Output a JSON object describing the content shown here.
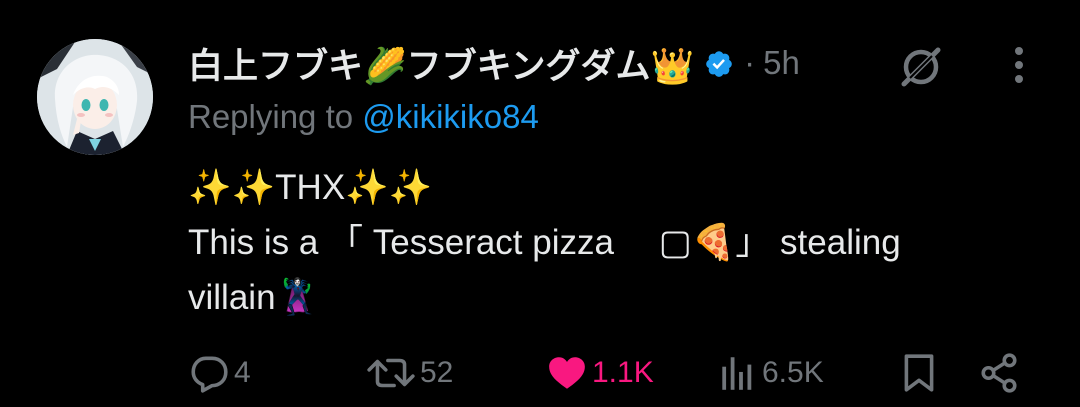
{
  "colors": {
    "background": "#000000",
    "text_primary": "#e7e9ea",
    "text_secondary": "#71767b",
    "link": "#1d9bf0",
    "like_active": "#f91880",
    "verified_badge": "#1d9bf0"
  },
  "tweet": {
    "display_name": "白上フブキ🌽フブキングダム👑",
    "verified": true,
    "separator": "·",
    "time": "5h",
    "replying_prefix": "Replying to ",
    "replying_handle": "@kikikiko84",
    "body_lines": [
      "✨✨THX✨✨",
      "This is a 「 Tesseract pizza 　▢🍕」 stealing",
      "villain🦹‍♀️"
    ]
  },
  "icons": {
    "avatar": "avatar-image",
    "verified": "verified-badge-icon",
    "grok": "grok-icon",
    "more": "more-options-icon",
    "reply": "reply-icon",
    "retweet": "retweet-icon",
    "like": "heart-icon",
    "views": "views-icon",
    "bookmark": "bookmark-icon",
    "share": "share-icon"
  },
  "actions": {
    "replies": "4",
    "retweets": "52",
    "likes": "1.1K",
    "liked": true,
    "views": "6.5K"
  }
}
